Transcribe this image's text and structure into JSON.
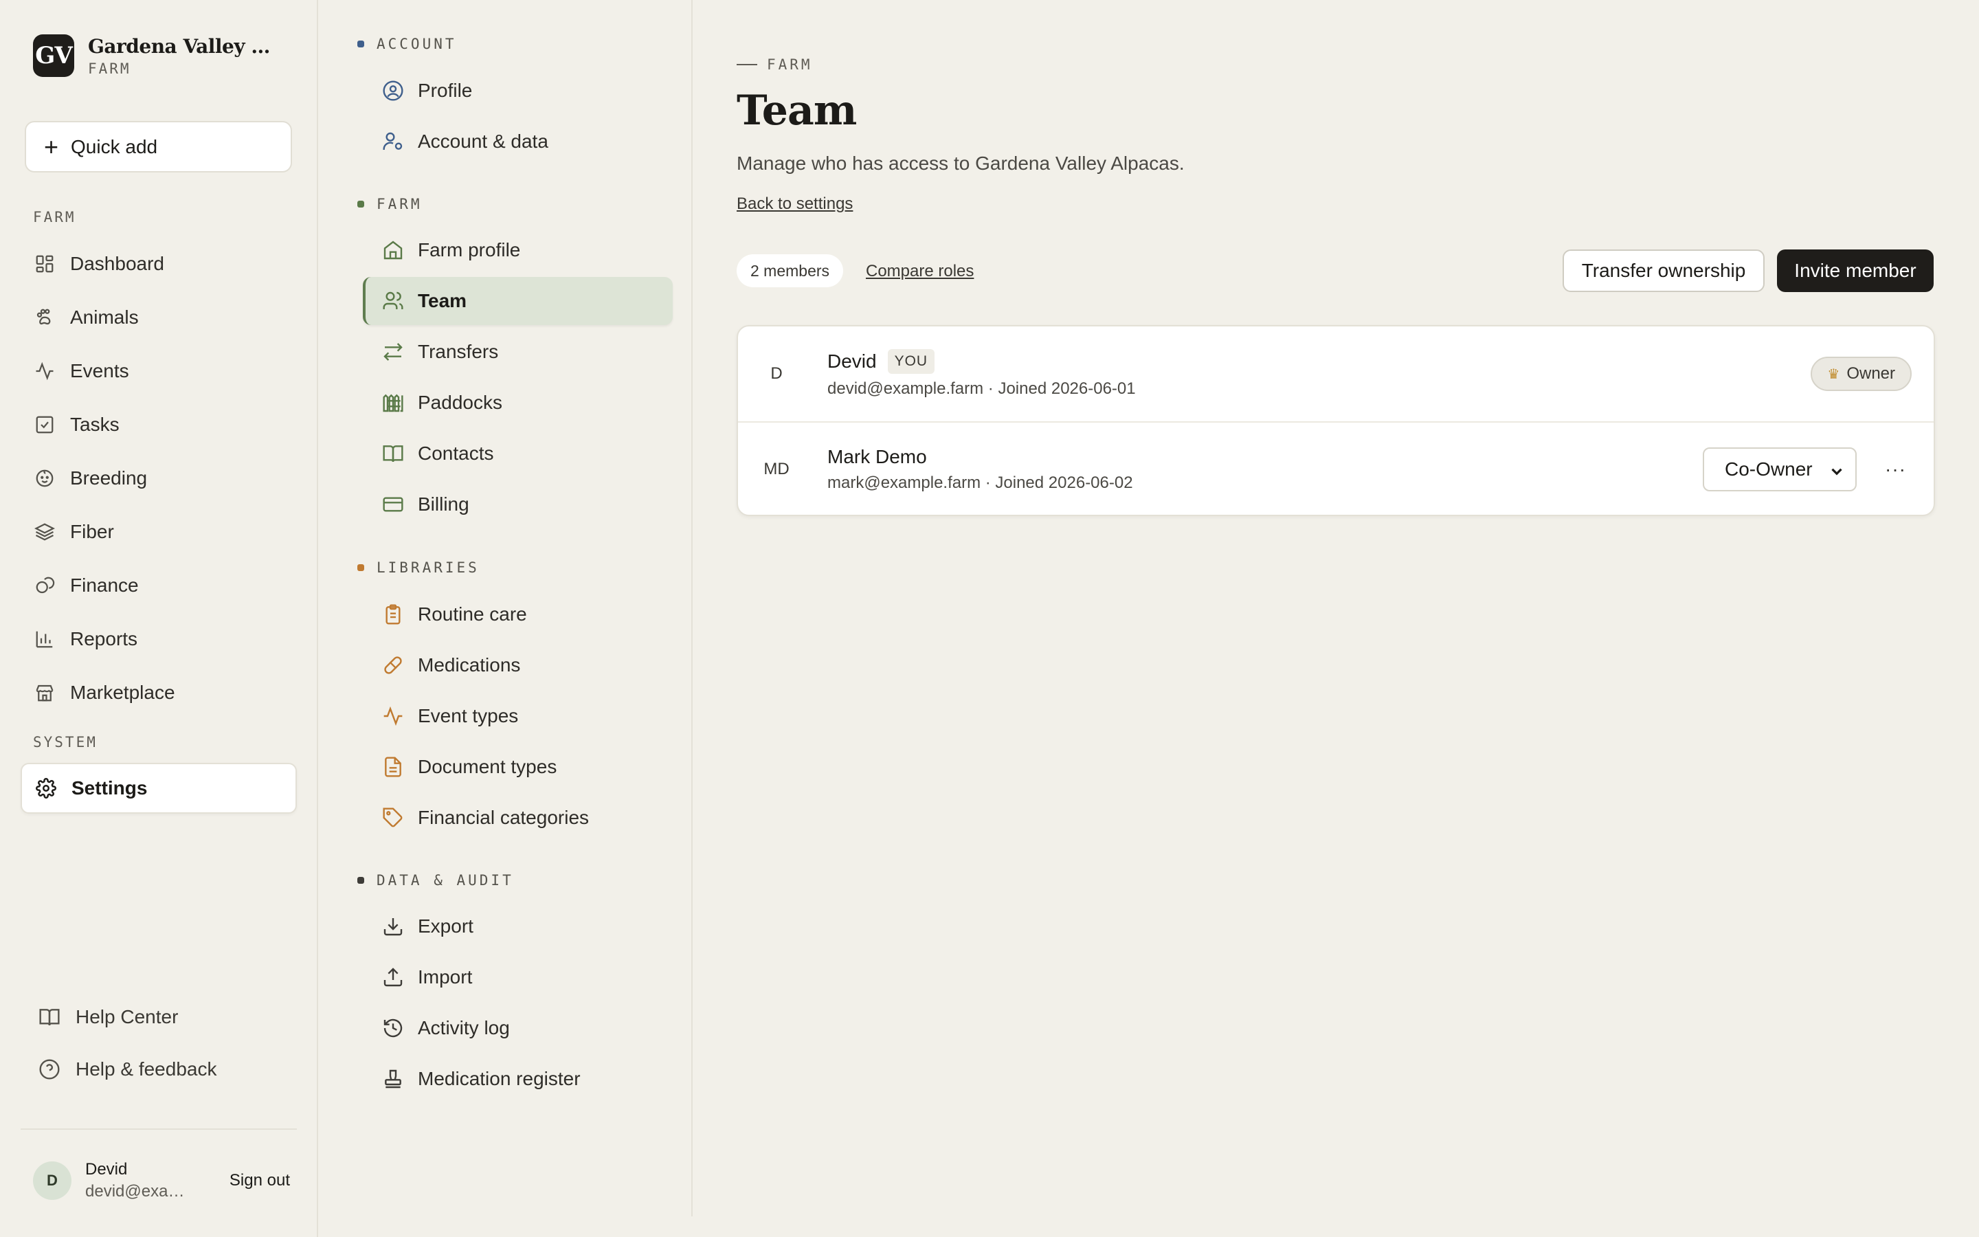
{
  "brand": {
    "initials": "GV",
    "name": "Gardena Valley Alpacas",
    "type": "FARM"
  },
  "sidebar": {
    "quick_add": "Quick add",
    "farm_label": "FARM",
    "items": [
      {
        "label": "Dashboard",
        "icon": "dashboard-icon"
      },
      {
        "label": "Animals",
        "icon": "paw-icon"
      },
      {
        "label": "Events",
        "icon": "activity-icon"
      },
      {
        "label": "Tasks",
        "icon": "checkbox-icon"
      },
      {
        "label": "Breeding",
        "icon": "baby-icon"
      },
      {
        "label": "Fiber",
        "icon": "layers-icon"
      },
      {
        "label": "Finance",
        "icon": "coins-icon"
      },
      {
        "label": "Reports",
        "icon": "bar-chart-icon"
      },
      {
        "label": "Marketplace",
        "icon": "store-icon"
      }
    ],
    "system_label": "SYSTEM",
    "settings": "Settings",
    "help_center": "Help Center",
    "help_feedback": "Help & feedback",
    "user": {
      "initial": "D",
      "name": "Devid",
      "email": "devid@example.farm",
      "signout": "Sign out"
    }
  },
  "subnav": {
    "account_label": "ACCOUNT",
    "account_items": [
      "Profile",
      "Account & data"
    ],
    "farm_label": "FARM",
    "farm_items": [
      "Farm profile",
      "Team",
      "Transfers",
      "Paddocks",
      "Contacts",
      "Billing"
    ],
    "libraries_label": "LIBRARIES",
    "libraries_items": [
      "Routine care",
      "Medications",
      "Event types",
      "Document types",
      "Financial categories"
    ],
    "data_label": "DATA & AUDIT",
    "data_items": [
      "Export",
      "Import",
      "Activity log",
      "Medication register"
    ],
    "colors": {
      "account": "#3f5f8c",
      "farm": "#5a7a48",
      "libraries": "#c07a30",
      "data": "#3e3c38"
    }
  },
  "main": {
    "eyebrow": "FARM",
    "title": "Team",
    "subtitle": "Manage who has access to Gardena Valley Alpacas.",
    "back_link": "Back to settings",
    "members_count": "2 members",
    "compare_roles": "Compare roles",
    "transfer_button": "Transfer ownership",
    "invite_button": "Invite member",
    "members": [
      {
        "initials": "D",
        "name": "Devid",
        "you_badge": "YOU",
        "meta": "devid@example.farm · Joined 2026-06-01",
        "role": "Owner"
      },
      {
        "initials": "MD",
        "name": "Mark Demo",
        "meta": "mark@example.farm · Joined 2026-06-02",
        "role": "Co-Owner",
        "more": "···"
      }
    ]
  }
}
